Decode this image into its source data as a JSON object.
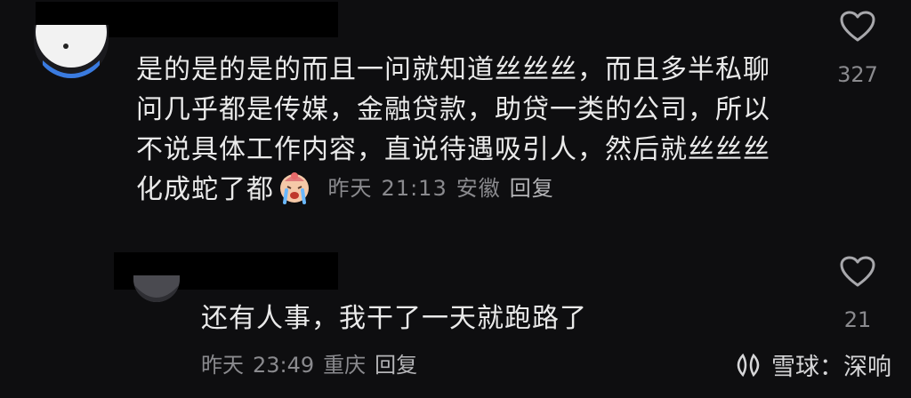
{
  "comments": [
    {
      "text_lines": [
        "是的是的是的而且一问就知道丝丝丝，而且多半私聊",
        "问几乎都是传媒，金融贷款，助贷一类的公司，所以",
        "不说具体工作内容，直说待遇吸引人，然后就丝丝丝"
      ],
      "last_line": "化成蛇了都",
      "emoji": "crying-face-emoji",
      "date": "昨天",
      "time": "21:13",
      "location": "安徽",
      "reply_label": "回复",
      "likes": "327"
    },
    {
      "text": "还有人事，我干了一天就跑路了",
      "date": "昨天",
      "time": "23:49",
      "location": "重庆",
      "reply_label": "回复",
      "likes": "21"
    }
  ],
  "watermark": {
    "brand": "雪球",
    "separator": "：",
    "user": "深响"
  },
  "colors": {
    "background": "#0e0e10",
    "text": "#eaeaea",
    "meta": "#8a8a8e",
    "heart_outline": "#a8a8ac"
  }
}
